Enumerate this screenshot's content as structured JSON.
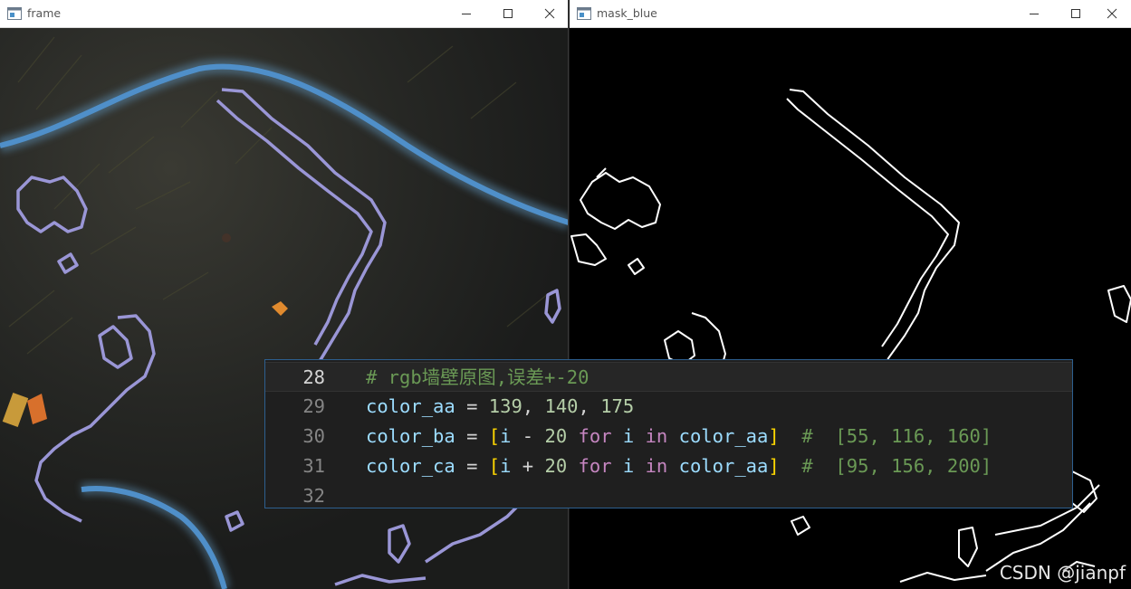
{
  "windows": {
    "frame": {
      "title": "frame"
    },
    "mask": {
      "title": "mask_blue"
    }
  },
  "icons": {
    "app": "opencv-window-icon",
    "minimize": "minimize-icon",
    "maximize": "maximize-icon",
    "close": "close-icon"
  },
  "colors": {
    "river_blue": "#4f8fc9",
    "wall_outline": "#9a96d6",
    "mask_background": "#000000",
    "mask_edges": "#ffffff",
    "code_background": "#1f1f1f",
    "code_border": "#2d5f8f"
  },
  "code": {
    "lines": [
      {
        "number": "28",
        "tokens": [
          {
            "t": "# rgb墙壁原图,误差+-20",
            "c": "comment"
          }
        ]
      },
      {
        "number": "29",
        "tokens": [
          {
            "t": "color_aa",
            "c": "var"
          },
          {
            "t": " = ",
            "c": "op"
          },
          {
            "t": "139",
            "c": "num"
          },
          {
            "t": ", ",
            "c": "op"
          },
          {
            "t": "140",
            "c": "num"
          },
          {
            "t": ", ",
            "c": "op"
          },
          {
            "t": "175",
            "c": "num"
          }
        ]
      },
      {
        "number": "30",
        "tokens": [
          {
            "t": "color_ba",
            "c": "var"
          },
          {
            "t": " = ",
            "c": "op"
          },
          {
            "t": "[",
            "c": "br"
          },
          {
            "t": "i",
            "c": "var"
          },
          {
            "t": " - ",
            "c": "op"
          },
          {
            "t": "20",
            "c": "num"
          },
          {
            "t": " ",
            "c": "op"
          },
          {
            "t": "for",
            "c": "kw"
          },
          {
            "t": " ",
            "c": "op"
          },
          {
            "t": "i",
            "c": "var"
          },
          {
            "t": " ",
            "c": "op"
          },
          {
            "t": "in",
            "c": "kw"
          },
          {
            "t": " ",
            "c": "op"
          },
          {
            "t": "color_aa",
            "c": "var"
          },
          {
            "t": "]",
            "c": "br"
          },
          {
            "t": "  #  [55, 116, 160]",
            "c": "comment"
          }
        ]
      },
      {
        "number": "31",
        "tokens": [
          {
            "t": "color_ca",
            "c": "var"
          },
          {
            "t": " = ",
            "c": "op"
          },
          {
            "t": "[",
            "c": "br"
          },
          {
            "t": "i",
            "c": "var"
          },
          {
            "t": " + ",
            "c": "op"
          },
          {
            "t": "20",
            "c": "num"
          },
          {
            "t": " ",
            "c": "op"
          },
          {
            "t": "for",
            "c": "kw"
          },
          {
            "t": " ",
            "c": "op"
          },
          {
            "t": "i",
            "c": "var"
          },
          {
            "t": " ",
            "c": "op"
          },
          {
            "t": "in",
            "c": "kw"
          },
          {
            "t": " ",
            "c": "op"
          },
          {
            "t": "color_aa",
            "c": "var"
          },
          {
            "t": "]",
            "c": "br"
          },
          {
            "t": "  #  [95, 156, 200]",
            "c": "comment"
          }
        ]
      },
      {
        "number": "32",
        "tokens": []
      }
    ],
    "current_line": "28"
  },
  "watermark": "CSDN @jianpf"
}
